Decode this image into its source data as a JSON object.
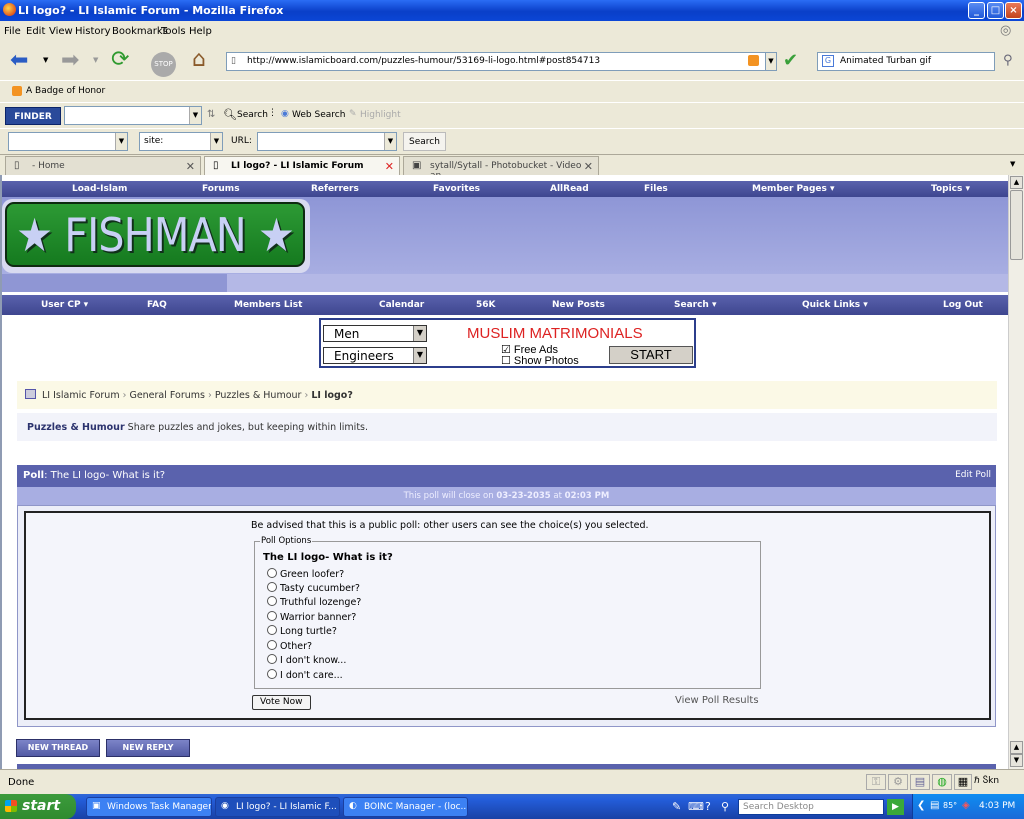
{
  "window": {
    "title": "LI logo? - LI Islamic Forum - Mozilla Firefox",
    "controls": [
      "_",
      "□",
      "×"
    ]
  },
  "menu": [
    "File",
    "Edit",
    "View",
    "History",
    "Bookmarks",
    "Tools",
    "Help"
  ],
  "address": {
    "url": "http://www.islamicboard.com/puzzles-humour/53169-li-logo.html#post854713",
    "search": "Animated Turban gif"
  },
  "bookmarks": {
    "item": "A Badge of Honor"
  },
  "finder": {
    "logo": "FINDER",
    "search": "Search",
    "web_search": "Web Search",
    "highlight": "Highlight"
  },
  "toolbar3": {
    "site": "site:",
    "url_label": "URL:",
    "search": "Search"
  },
  "tabs": [
    {
      "label": "- Home"
    },
    {
      "label": "LI logo? - LI Islamic Forum"
    },
    {
      "label": "sytall/Sytall - Photobucket - Video an..."
    }
  ],
  "topnav": [
    "Load-Islam",
    "Forums",
    "Referrers",
    "Favorites",
    "AllRead",
    "Files",
    "Member Pages ▾",
    "Topics ▾"
  ],
  "logo_text": "FISHMAN",
  "subnav": [
    "User CP ▾",
    "FAQ",
    "Members List",
    "Calendar",
    "56K",
    "New Posts",
    "Search ▾",
    "Quick Links ▾",
    "Log Out"
  ],
  "ad": {
    "sel1": "Men",
    "sel2": "Engineers",
    "title": "MUSLIM MATRIMONIALS",
    "opt1": "Free Ads",
    "opt2": "Show Photos",
    "start": "START"
  },
  "breadcrumb": {
    "items": [
      "LI Islamic Forum",
      "General Forums",
      "Puzzles & Humour"
    ],
    "current": "LI logo?"
  },
  "forum": {
    "name": "Puzzles & Humour",
    "desc": "Share puzzles and jokes, but keeping within limits."
  },
  "poll": {
    "label": "Poll",
    "title": ": The LI logo- What is it?",
    "edit": "Edit Poll",
    "close_prefix": "This poll will close on",
    "close_date": "03-23-2035",
    "at": "at",
    "close_time": "02:03 PM",
    "advice": "Be advised that this is a public poll: other users can see the choice(s) you selected.",
    "legend": "Poll Options",
    "question": "The LI logo- What is it?",
    "options": [
      "Green loofer?",
      "Tasty cucumber?",
      "Truthful lozenge?",
      "Warrior banner?",
      "Long turtle?",
      "Other?",
      "I don't know...",
      "I don't care..."
    ],
    "vote": "Vote Now",
    "results": "View Poll Results"
  },
  "buttons": {
    "new_thread": "NEW THREAD",
    "new_reply": "NEW REPLY"
  },
  "status": {
    "text": "Done",
    "right": "ℏ Ⴝkn"
  },
  "taskbar": {
    "start": "start",
    "tasks": [
      "Windows Task Manager",
      "LI logo? - LI Islamic F...",
      "BOINC Manager - (loc..."
    ],
    "search": "Search Desktop",
    "clock": "4:03 PM",
    "temp": "85°"
  }
}
